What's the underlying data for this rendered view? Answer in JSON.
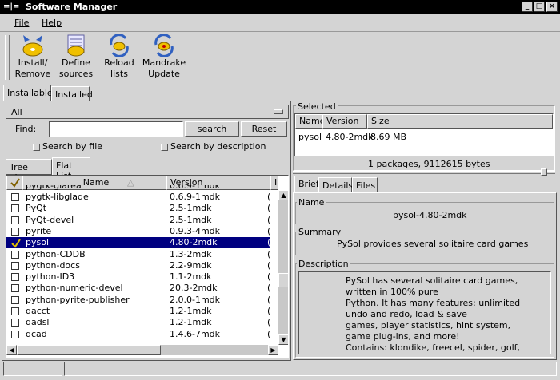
{
  "window": {
    "title": "Software Manager"
  },
  "menu": {
    "file": "File",
    "help": "Help"
  },
  "toolbar": [
    {
      "line1": "Install/",
      "line2": "Remove",
      "icon": "install-remove-icon"
    },
    {
      "line1": "Define",
      "line2": "sources",
      "icon": "define-sources-icon"
    },
    {
      "line1": "Reload",
      "line2": "lists",
      "icon": "reload-lists-icon"
    },
    {
      "line1": "Mandrake",
      "line2": "Update",
      "icon": "mandrake-update-icon"
    }
  ],
  "top_tabs": {
    "installable": "Installable",
    "installed": "Installed"
  },
  "filter": {
    "selected": "All"
  },
  "find": {
    "label": "Find:",
    "value": "",
    "search": "search",
    "reset": "Reset"
  },
  "options": {
    "by_file": "Search by file",
    "by_description": "Search by description"
  },
  "view_tabs": {
    "tree": "Tree view",
    "flat": "Flat List"
  },
  "list": {
    "columns": {
      "name": "Name",
      "version": "Version",
      "extra": "In"
    },
    "partial_row": {
      "name": "pygtk-glarea",
      "version": "0.6.9-1mdk"
    },
    "rows": [
      {
        "name": "pygtk-libglade",
        "version": "0.6.9-1mdk",
        "checked": false,
        "selected": false
      },
      {
        "name": "PyQt",
        "version": "2.5-1mdk",
        "checked": false,
        "selected": false
      },
      {
        "name": "PyQt-devel",
        "version": "2.5-1mdk",
        "checked": false,
        "selected": false
      },
      {
        "name": "pyrite",
        "version": "0.9.3-4mdk",
        "checked": false,
        "selected": false
      },
      {
        "name": "pysol",
        "version": "4.80-2mdk",
        "checked": true,
        "selected": true
      },
      {
        "name": "python-CDDB",
        "version": "1.3-2mdk",
        "checked": false,
        "selected": false
      },
      {
        "name": "python-docs",
        "version": "2.2-9mdk",
        "checked": false,
        "selected": false
      },
      {
        "name": "python-ID3",
        "version": "1.1-2mdk",
        "checked": false,
        "selected": false
      },
      {
        "name": "python-numeric-devel",
        "version": "20.3-2mdk",
        "checked": false,
        "selected": false
      },
      {
        "name": "python-pyrite-publisher",
        "version": "2.0.0-1mdk",
        "checked": false,
        "selected": false
      },
      {
        "name": "qacct",
        "version": "1.2-1mdk",
        "checked": false,
        "selected": false
      },
      {
        "name": "qadsl",
        "version": "1.2-1mdk",
        "checked": false,
        "selected": false
      },
      {
        "name": "qcad",
        "version": "1.4.6-7mdk",
        "checked": false,
        "selected": false
      }
    ]
  },
  "selected_panel": {
    "label": "Selected",
    "columns": {
      "name": "Name",
      "version": "Version",
      "size": "Size"
    },
    "row": {
      "name": "pysol",
      "version": "4.80-2mdk",
      "size": "8.69 MB"
    },
    "summary": "1 packages, 9112615 bytes"
  },
  "detail_tabs": {
    "brief": "Brief",
    "details": "Details",
    "files": "Files"
  },
  "brief": {
    "name_label": "Name",
    "name_value": "pysol-4.80-2mdk",
    "summary_label": "Summary",
    "summary_value": "PySol provides several solitaire card games",
    "description_label": "Description",
    "description_lines": [
      "PySol has several solitaire card games,",
      "written in 100% pure",
      "Python. It has many features: unlimited",
      "undo and redo, load & save",
      "games, player statistics, hint system,",
      "game plug-ins, and more!",
      "Contains: klondike, freecel, spider, golf,"
    ]
  },
  "colors": {
    "selection": "#000080",
    "background": "#d4d4d4",
    "titlebar": "#000000"
  }
}
